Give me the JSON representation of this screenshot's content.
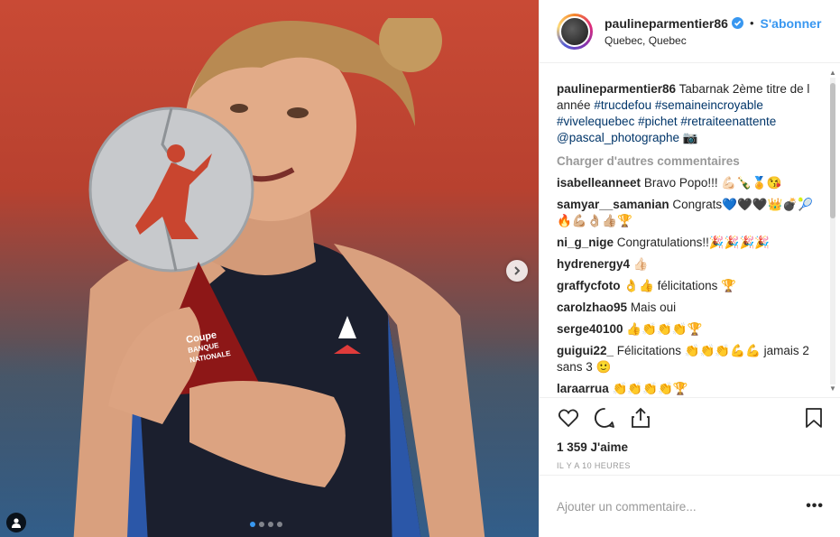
{
  "post": {
    "username": "paulineparmentier86",
    "follow_label": "S'abonner",
    "bullet": "•",
    "location": "Quebec, Quebec",
    "trophy_text": [
      "Coupe",
      "BANQUE",
      "NATIONALE"
    ]
  },
  "caption": {
    "username": "paulineparmentier86",
    "text": "Tabarnak 2ème titre de l année",
    "hashtags": [
      "#trucdefou",
      "#semaineincroyable",
      "#vivelequebec",
      "#pichet",
      "#retraiteenattente"
    ],
    "mention": "@pascal_photographe",
    "emoji": "📷"
  },
  "load_more_label": "Charger d'autres commentaires",
  "comments": [
    {
      "user": "isabelleanneet",
      "text": "Bravo Popo!!! 💪🏻🍾🏅😘"
    },
    {
      "user": "samyar__samanian",
      "text": "Congrats💙🖤🖤👑💣🎾🔥💪🏼👌🏼👍🏼🏆"
    },
    {
      "user": "ni_g_nige",
      "text": "Congratulations!!🎉🎉🎉🎉"
    },
    {
      "user": "hydrenergy4",
      "text": "👍🏻"
    },
    {
      "user": "graffycfoto",
      "text": "👌👍 félicitations 🏆"
    },
    {
      "user": "carolzhao95",
      "text": "Mais oui"
    },
    {
      "user": "serge40100",
      "text": "👍👏👏👏🏆"
    },
    {
      "user": "guigui22_",
      "text": "Félicitations 👏👏👏💪💪 jamais 2 sans 3 🙂"
    },
    {
      "user": "laraarrua",
      "text": "👏👏👏👏🏆"
    }
  ],
  "likes_label": "1 359 J'aime",
  "time_label": "IL Y A 10 HEURES",
  "add_comment_placeholder": "Ajouter un commentaire...",
  "more_label": "•••",
  "carousel": {
    "count": 4,
    "active": 1
  },
  "colors": {
    "link": "#003569",
    "follow": "#3897f0",
    "muted": "#999999"
  },
  "icons": [
    "heart-icon",
    "comment-icon",
    "share-icon",
    "bookmark-icon",
    "verified-icon",
    "chevron-right-icon",
    "user-tag-icon"
  ]
}
